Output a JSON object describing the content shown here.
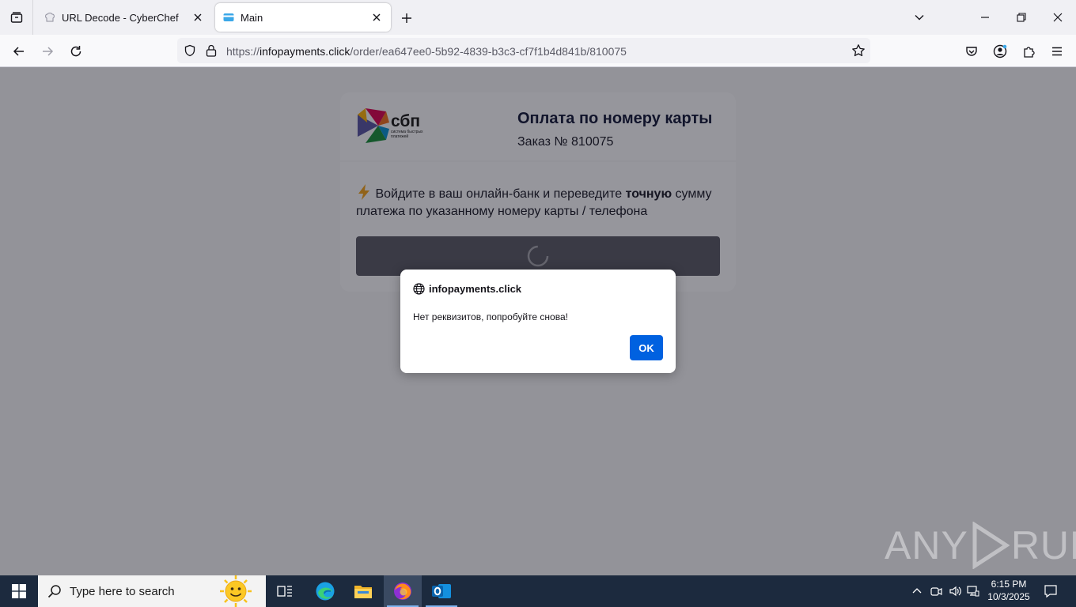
{
  "browser": {
    "tabs": [
      {
        "title": "URL Decode - CyberChef",
        "active": false
      },
      {
        "title": "Main",
        "active": true
      }
    ],
    "url": {
      "scheme": "https://",
      "domain": "infopayments.click",
      "path": "/order/ea647ee0-5b92-4839-b3c3-cf7f1b4d841b/810075"
    }
  },
  "page": {
    "logo": {
      "brand": "сбп",
      "tagline_1": "система быстрых",
      "tagline_2": "платежей"
    },
    "title": "Оплата по номеру карты",
    "order": "Заказ № 810075",
    "instruction_before": "Войдите в ваш онлайн-банк и переведите ",
    "instruction_bold": "точную",
    "instruction_after": " сумму платежа по указанному номеру карты / телефона"
  },
  "dialog": {
    "host": "infopayments.click",
    "message": "Нет реквизитов, попробуйте снова!",
    "ok_label": "OK"
  },
  "watermark": {
    "left": "ANY",
    "right": "RUN"
  },
  "taskbar": {
    "search_placeholder": "Type here to search",
    "time": "6:15 PM",
    "date": "10/3/2025"
  },
  "colors": {
    "accent": "#0061e0",
    "taskbar": "#1c2a3e",
    "page_title": "#151a3a"
  }
}
